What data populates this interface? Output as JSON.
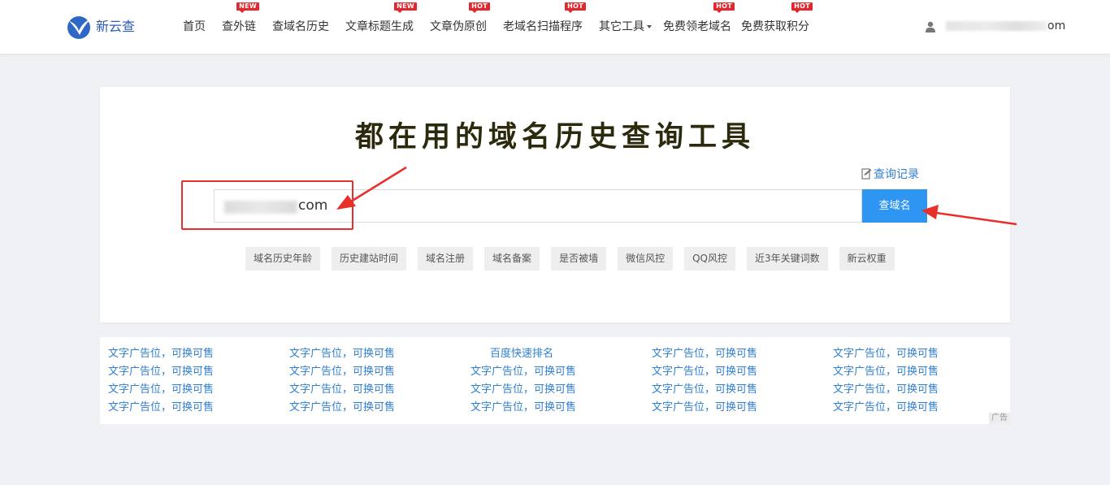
{
  "header": {
    "logo_text": "新云查",
    "nav": [
      {
        "label": "首页",
        "badge": ""
      },
      {
        "label": "查外链",
        "badge": "NEW"
      },
      {
        "label": "查域名历史",
        "badge": ""
      },
      {
        "label": "文章标题生成",
        "badge": "NEW"
      },
      {
        "label": "文章伪原创",
        "badge": "HOT"
      },
      {
        "label": "老域名扫描程序",
        "badge": "HOT"
      },
      {
        "label": "其它工具",
        "badge": ""
      },
      {
        "label": "免费领老域名",
        "badge": "HOT"
      },
      {
        "label": "免费获取积分",
        "badge": "HOT"
      }
    ],
    "user_suffix": "om"
  },
  "search": {
    "title": "都在用的域名历史查询工具",
    "history_link": "查询记录",
    "input_suffix": "com",
    "button_label": "查域名",
    "tags": [
      "域名历史年龄",
      "历史建站时间",
      "域名注册",
      "域名备案",
      "是否被墙",
      "微信风控",
      "QQ风控",
      "近3年关键词数",
      "新云权重"
    ]
  },
  "ads": {
    "rows": [
      [
        "文字广告位，可换可售",
        "文字广告位，可换可售",
        "百度快速排名",
        "文字广告位，可换可售",
        "文字广告位，可换可售"
      ],
      [
        "文字广告位，可换可售",
        "文字广告位，可换可售",
        "文字广告位，可换可售",
        "文字广告位，可换可售",
        "文字广告位，可换可售"
      ],
      [
        "文字广告位，可换可售",
        "文字广告位，可换可售",
        "文字广告位，可换可售",
        "文字广告位，可换可售",
        "文字广告位，可换可售"
      ],
      [
        "文字广告位，可换可售",
        "文字广告位，可换可售",
        "文字广告位，可换可售",
        "文字广告位，可换可售",
        "文字广告位，可换可售"
      ]
    ],
    "ad_label": "广告"
  },
  "colors": {
    "accent": "#2f95f2",
    "link": "#2f7fd1",
    "badge": "#e0282e",
    "annotation": "#e8302a"
  }
}
